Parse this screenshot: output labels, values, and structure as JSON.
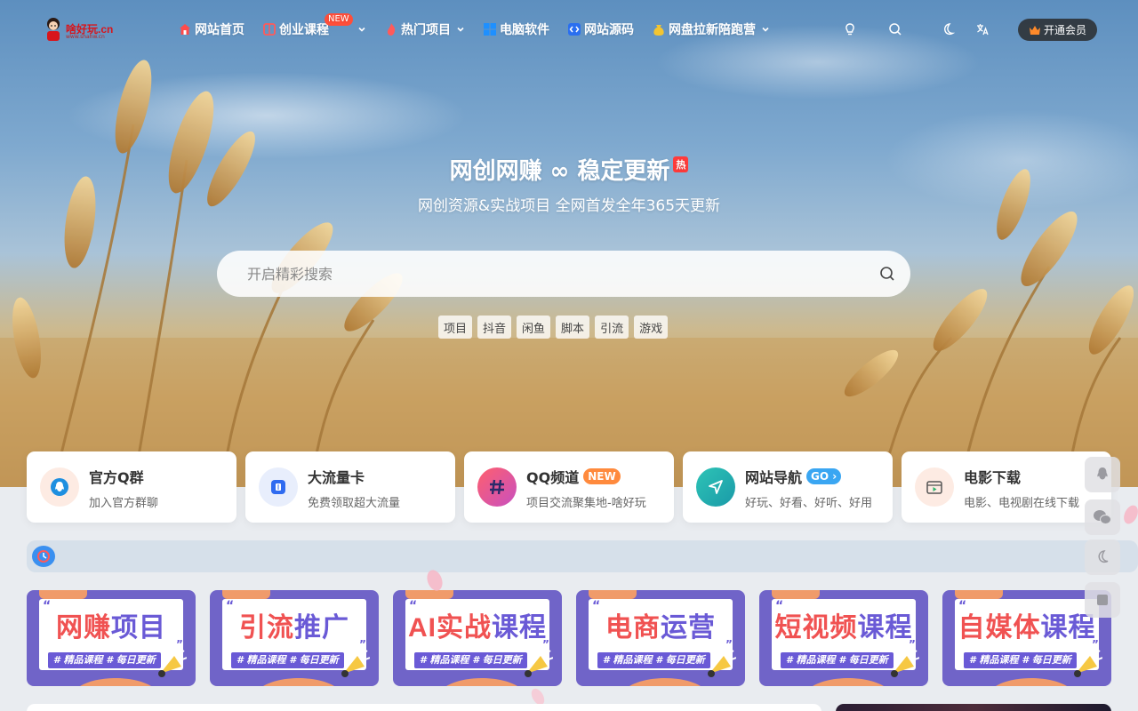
{
  "logo": {
    "text": "啥好玩.cn",
    "sub": "www.shahw.cn"
  },
  "nav": {
    "items": [
      {
        "label": "网站首页",
        "icon": "home-icon",
        "has_dropdown": false
      },
      {
        "label": "创业课程",
        "icon": "book-icon",
        "has_dropdown": true,
        "badge": "NEW"
      },
      {
        "label": "热门项目",
        "icon": "fire-icon",
        "has_dropdown": true
      },
      {
        "label": "电脑软件",
        "icon": "windows-icon",
        "has_dropdown": false
      },
      {
        "label": "网站源码",
        "icon": "code-icon",
        "has_dropdown": false
      },
      {
        "label": "网盘拉新陪跑营",
        "icon": "money-bag-icon",
        "has_dropdown": true
      }
    ]
  },
  "header_tools": {
    "icons": [
      "lightbulb-icon",
      "search-icon",
      "moon-icon",
      "translate-icon"
    ],
    "vip_label": "开通会员"
  },
  "hero": {
    "title": "网创网赚 ∞ 稳定更新",
    "hot_badge": "热",
    "subtitle": "网创资源&实战项目 全网首发全年365天更新",
    "search_placeholder": "开启精彩搜索",
    "tags": [
      "项目",
      "抖音",
      "闲鱼",
      "脚本",
      "引流",
      "游戏"
    ]
  },
  "cards": [
    {
      "title": "官方Q群",
      "desc": "加入官方群聊",
      "icon": "qq-icon",
      "pill": ""
    },
    {
      "title": "大流量卡",
      "desc": "免费领取超大流量",
      "icon": "sim-card-icon",
      "pill": ""
    },
    {
      "title": "QQ频道",
      "desc": "项目交流聚集地-啥好玩",
      "icon": "hashtag-icon",
      "pill": "NEW"
    },
    {
      "title": "网站导航",
      "desc": "好玩、好看、好听、好用",
      "icon": "navigation-icon",
      "pill": "GO"
    },
    {
      "title": "电影下载",
      "desc": "电影、电视剧在线下载",
      "icon": "video-icon",
      "pill": ""
    }
  ],
  "banners": [
    {
      "title_a": "网赚",
      "title_b": "项目",
      "sub": "# 精品课程  # 每日更新"
    },
    {
      "title_a": "引流",
      "title_b": "推广",
      "sub": "# 精品课程  # 每日更新"
    },
    {
      "title_a": "AI实战",
      "title_b": "课程",
      "sub": "# 精品课程  # 每日更新"
    },
    {
      "title_a": "电商",
      "title_b": "运营",
      "sub": "# 精品课程  # 每日更新"
    },
    {
      "title_a": "短视频",
      "title_b": "课程",
      "sub": "# 精品课程  # 每日更新"
    },
    {
      "title_a": "自媒体",
      "title_b": "课程",
      "sub": "# 精品课程  # 每日更新"
    }
  ],
  "side_bar": [
    "qq-icon",
    "wechat-icon",
    "moon-icon",
    "sign-icon"
  ],
  "colors": {
    "accent_red": "#f05252",
    "accent_purple": "#6a5ad6",
    "banner_bg": "#7064c8",
    "new_badge": "#ff4e3a",
    "notice_bar": "#d6e0ea"
  }
}
